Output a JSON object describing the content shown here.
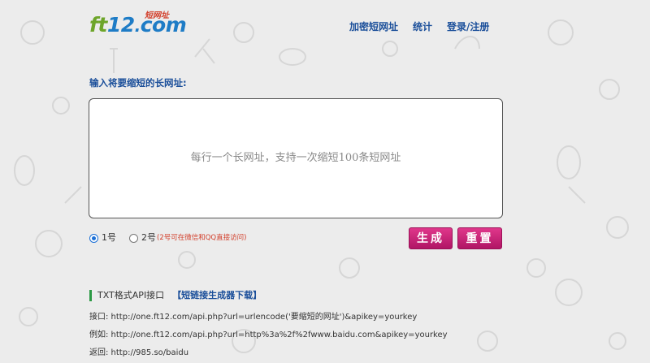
{
  "logo": {
    "text_ft": "ft",
    "text_12": "12",
    "text_dot": ".",
    "text_com": "com",
    "subtitle": "短网址"
  },
  "nav": {
    "items": [
      {
        "label": "加密短网址"
      },
      {
        "label": "统计"
      },
      {
        "label": "登录/注册"
      }
    ]
  },
  "form": {
    "label": "输入将要缩短的长网址:",
    "placeholder": "每行一个长网址，支持一次缩短100条短网址",
    "radio_1": {
      "label": "1号",
      "selected": true
    },
    "radio_2": {
      "label": "2号",
      "selected": false,
      "hint": "(2号可在微信和QQ直接访问)"
    },
    "generate_label": "生成",
    "reset_label": "重置"
  },
  "api": {
    "title": "TXT格式API接口",
    "link": "【短链接生成器下载】",
    "lines": [
      "接口: http://one.ft12.com/api.php?url=urlencode('要缩短的网址')&apikey=yourkey",
      "例如: http://one.ft12.com/api.php?url=http%3a%2f%2fwww.baidu.com&apikey=yourkey",
      "返回: http://985.so/baidu"
    ]
  },
  "colors": {
    "brand_green": "#6da52a",
    "brand_blue": "#1e7cc6",
    "nav_blue": "#1b4f9a",
    "button_pink": "#c81e73",
    "accent_green": "#2c9a45",
    "hint_red": "#d23d29"
  }
}
